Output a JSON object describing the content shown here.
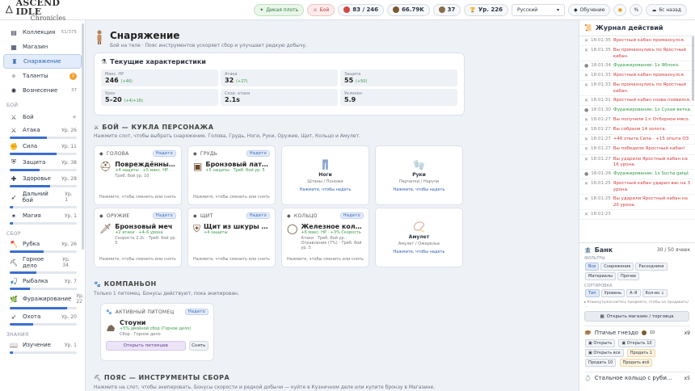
{
  "app": {
    "title": "ASCEND IDLE",
    "subtitle": "Chronicles"
  },
  "top": {
    "dungeon": "Дикая плоть",
    "fight": "Бой",
    "hp": "83 / 246",
    "gold": "66.79K",
    "gems": "37",
    "level": "Ур. 226",
    "language": "Русский",
    "training": "Обучение",
    "time_ago": "6с назад"
  },
  "sidebar": {
    "items": [
      {
        "label": "Коллекция",
        "count": "51/375"
      },
      {
        "label": "Магазин",
        "count": ""
      },
      {
        "label": "Снаряжение",
        "count": ""
      },
      {
        "label": "Таланты",
        "count": "2"
      },
      {
        "label": "Вознесение",
        "count": "37"
      }
    ],
    "sec_combat": "БОЙ",
    "fight": "Бой",
    "combat": [
      {
        "label": "Атака",
        "lv": "Ур. 26",
        "p": 0.55
      },
      {
        "label": "Сила",
        "lv": "Ур. 11",
        "p": 0.7
      },
      {
        "label": "Защита",
        "lv": "Ур. 38",
        "p": 0.45
      },
      {
        "label": "Здоровье",
        "lv": "Ур. 28",
        "p": 0.6
      },
      {
        "label": "Дальний бой",
        "lv": "Ур. 1",
        "p": 0.05
      },
      {
        "label": "Магия",
        "lv": "Ур. 1",
        "p": 0.05
      }
    ],
    "sec_gather": "СБОР",
    "gather": [
      {
        "label": "Рубка",
        "lv": "Ур. 26",
        "p": 0.5
      },
      {
        "label": "Горное дело",
        "lv": "Ур. 34",
        "p": 0.4
      },
      {
        "label": "Рыбалка",
        "lv": "Ур. 7",
        "p": 0.3
      },
      {
        "label": "Фуражирование",
        "lv": "Ур. 22",
        "p": 0.85
      },
      {
        "label": "Охота",
        "lv": "Ур. 20",
        "p": 0.35
      }
    ],
    "sec_know": "ЗНАНИЯ",
    "know": [
      {
        "label": "Изучение",
        "lv": "Ур. 1",
        "p": 0.05
      }
    ]
  },
  "page": {
    "title": "Снаряжение",
    "subtitle": "Бой на теле · Пояс инструментов ускоряет сбор и улучшает редкую добычу."
  },
  "stats": {
    "title": "Текущие характеристики",
    "items": [
      {
        "label": "Макс. HP",
        "value": "246",
        "bonus": "(+46)"
      },
      {
        "label": "Атака",
        "value": "32",
        "bonus": "(+27)"
      },
      {
        "label": "Защита",
        "value": "55",
        "bonus": "(+50)"
      },
      {
        "label": "Урон",
        "value": "5–20",
        "bonus": "(+4/+16)"
      },
      {
        "label": "Скор. атаки",
        "value": "2.1s",
        "bonus": ""
      },
      {
        "label": "Уклонон",
        "value": "5.9",
        "bonus": ""
      }
    ]
  },
  "doll": {
    "title": "БОЙ — КУКЛА ПЕРСОНАЖА",
    "desc": "Нажмите слот, чтобы выбрать снаряжение. Голова, Грудь, Ноги, Руки, Оружие, Щит, Кольцо и Амулет.",
    "slots": [
      {
        "slot": "ГОЛОВА",
        "badge": "Надето",
        "name": "Повреждённый же...",
        "stats": "+4 защиты · +5 макс. HP ·",
        "req": "Треб. бой ур. 10",
        "hint": "Нажмите, чтобы сменить или снять"
      },
      {
        "slot": "ГРУДЬ",
        "badge": "Надето",
        "name": "Бронзовый латный...",
        "stats": "+5 защиты · Треб. бой ур. 5",
        "req": "",
        "hint": "Нажмите, чтобы сменить или снять"
      },
      {
        "slot": "ОРУЖИЕ",
        "badge": "Надето",
        "name": "Бронзовый меч",
        "stats": "+2 атаки · +4–6 урона",
        "req": "Скорость 2.2с · Треб. бой ур. 5",
        "hint": "Нажмите, чтобы сменить или снять"
      },
      {
        "slot": "ЩИТ",
        "badge": "Надето",
        "name": "Щит из шкуры гоб...",
        "stats": "+4 защиты",
        "req": "",
        "hint": "Нажмите, чтобы сменить или снять"
      },
      {
        "slot": "КОЛЬЦО",
        "badge": "Надето",
        "name": "Железное кольцо ...",
        "stats": "+6 макс. HP · +3% Скорость",
        "req": "Атаки · Треб. бой ур. Отравление (7%) · Треб. бой ур. 5",
        "hint": "Нажмите, чтобы сменить или снять"
      }
    ],
    "empty": [
      {
        "name": "Ноги",
        "desc": "Штаны / Поножи",
        "hint": "Нажмите, чтобы надеть"
      },
      {
        "name": "Руки",
        "desc": "Перчатки / Наручи",
        "hint": "Нажмите, чтобы надеть"
      },
      {
        "name": "Амулет",
        "desc": "Амулет / Ожерелье",
        "hint": "Нажмите, чтобы надеть"
      }
    ]
  },
  "companion": {
    "title": "КОМПАНЬОН",
    "desc": "Только 1 питомец. Бонусы действуют, пока экипирован.",
    "card_title": "АКТИВНЫЙ ПИТОМЕЦ",
    "badge": "Надето",
    "name": "Стоуни",
    "stats": "+5% двойной сбор (Горное дело)",
    "type": "Сбор · Горное дело",
    "open": "Открыть питомцев",
    "remove": "Снять"
  },
  "belt": {
    "title": "ПОЯС — ИНСТРУМЕНТЫ СБОРА",
    "desc": "Нажмите на слот, чтобы экипировать. Бонусы скорости и редкой добычи — куйте в Кузнечном деле или купите бронзу в Магазине."
  },
  "log": {
    "title": "Журнал действий",
    "rows": [
      {
        "t": "18:01:35",
        "m": "Яростный кабан промахнулся.",
        "c": "red"
      },
      {
        "t": "18:01:35",
        "m": "Вы промахнулись по Яростный кабан.",
        "c": "red"
      },
      {
        "t": "18:01:34",
        "m": "Фуражирование: 1x Яблоко.",
        "c": "grn"
      },
      {
        "t": "18:01:33",
        "m": "Яростный кабан промахнулся.",
        "c": "red"
      },
      {
        "t": "18:01:33",
        "m": "Вы промахнулись по Яростный кабан.",
        "c": "red"
      },
      {
        "t": "18:01:31",
        "m": "Яростный кабан снова появился.",
        "c": "red"
      },
      {
        "t": "18:01:30",
        "m": "Фуражирование: 1x Сухая ветка.",
        "c": "grn"
      },
      {
        "t": "18:01:27",
        "m": "Вы получили 1× Отборное мясо.",
        "c": "red"
      },
      {
        "t": "18:01:27",
        "m": "Вы собрали 14 золота.",
        "c": "red"
      },
      {
        "t": "18:01:27",
        "m": "+46 опыта Сила · +15 опыта ОЗ",
        "c": "red"
      },
      {
        "t": "18:01:27",
        "m": "Вы победили Яростный кабан!",
        "c": "red"
      },
      {
        "t": "18:01:27",
        "m": "Вы ударили Яростный кабан на 16 урона.",
        "c": "red"
      },
      {
        "t": "18:01:26",
        "m": "Фуражирование: 1x Sucha gałąź.",
        "c": "grn"
      },
      {
        "t": "18:01:25",
        "m": "Яростный кабан ударил вас на 3 урона.",
        "c": "red"
      },
      {
        "t": "18:01:25",
        "m": "Вы ударили Яростный кабан на 20 урона.",
        "c": "red"
      },
      {
        "t": "18:01:23",
        "m": "",
        "c": "red"
      }
    ]
  },
  "bank": {
    "title": "Банк",
    "slots": "30 / 50 ячеек",
    "filters_label": "ФИЛЬТРЫ",
    "filters": [
      "Все",
      "Снаряжение",
      "Расходники",
      "Материалы",
      "Прочее"
    ],
    "sort_label": "СОРТИРОВКА",
    "sort": [
      "Тип",
      "Уровень",
      "A–Я",
      "Кол-во ↓"
    ],
    "note": "▸ Кликнуть/коснитесь предмета, чтобы не продавать/ …",
    "shop": "Открыть магазин / торговца",
    "item1": {
      "name": "Птичье гнездо",
      "qty": "10",
      "count": "x9",
      "open": "Открыть",
      "open10": "Открыть 10",
      "open_all": "Открыть все",
      "sell1": "Продать 1",
      "sell10": "Продать 10",
      "sell_all": "Продать всё"
    },
    "item2": {
      "name": "Стальное кольцо с руби...",
      "count": "x5"
    }
  }
}
